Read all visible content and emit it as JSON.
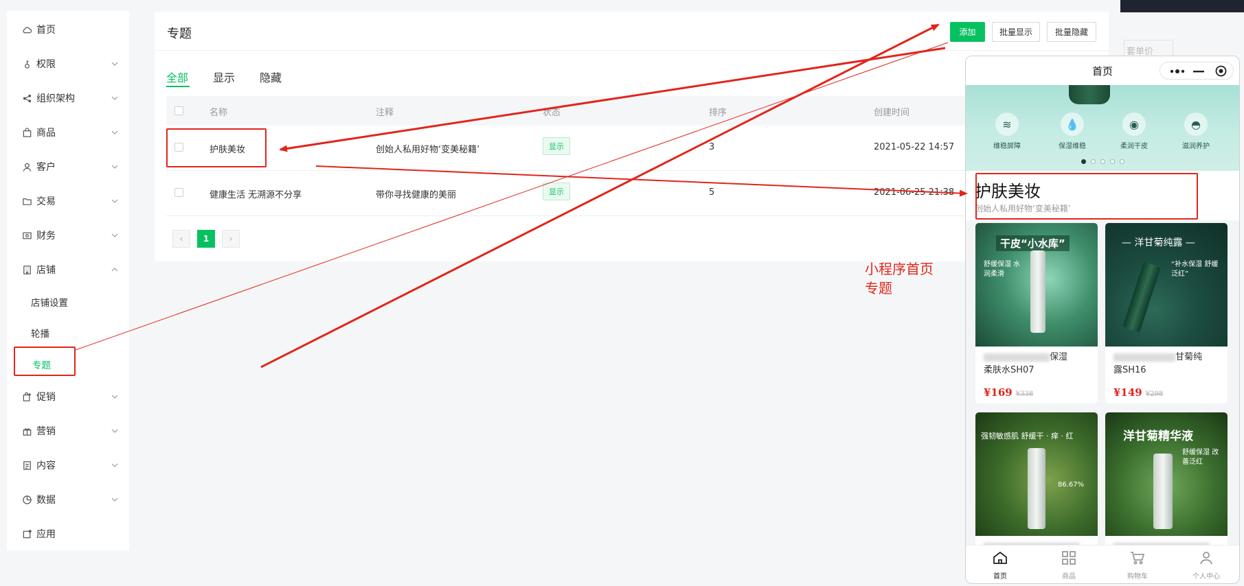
{
  "sidebar": {
    "items": [
      {
        "label": "首页",
        "icon": "cloud-icon"
      },
      {
        "label": "权限",
        "icon": "key-icon"
      },
      {
        "label": "组织架构",
        "icon": "share-icon"
      },
      {
        "label": "商品",
        "icon": "bag-icon"
      },
      {
        "label": "客户",
        "icon": "user-icon"
      },
      {
        "label": "交易",
        "icon": "folder-icon"
      },
      {
        "label": "财务",
        "icon": "wallet-icon"
      },
      {
        "label": "店铺",
        "icon": "store-icon"
      }
    ],
    "store_sub": [
      "店铺设置",
      "轮播",
      "专题"
    ],
    "items_after": [
      {
        "label": "促销",
        "icon": "promo-icon"
      },
      {
        "label": "营销",
        "icon": "gift-icon"
      },
      {
        "label": "内容",
        "icon": "document-icon"
      },
      {
        "label": "数据",
        "icon": "pie-chart-icon"
      },
      {
        "label": "应用",
        "icon": "app-icon"
      }
    ]
  },
  "panel": {
    "title": "专题",
    "buttons": {
      "add": "添加",
      "batch_show": "批量显示",
      "batch_hide": "批量隐藏"
    },
    "tabs": [
      "全部",
      "显示",
      "隐藏"
    ],
    "columns": [
      "名称",
      "注释",
      "状态",
      "排序",
      "创建时间"
    ],
    "rows": [
      {
        "name": "护肤美妆",
        "note": "创始人私用好物‘变美秘籍’",
        "status": "显示",
        "sort": "3",
        "created": "2021-05-22 14:57"
      },
      {
        "name": "健康生活 无溯源不分享",
        "note": "带你寻找健康的美丽",
        "status": "显示",
        "sort": "5",
        "created": "2021-06-25 21:38"
      }
    ],
    "pager": {
      "prev": "‹",
      "current": "1",
      "next": "›"
    }
  },
  "background": {
    "ghost_label": "套单价"
  },
  "annotation": {
    "line1": "小程序首页",
    "line2": "专题"
  },
  "phone": {
    "title": "首页",
    "features": [
      "维稳屏障",
      "保湿维稳",
      "柔润干皮",
      "滋润养护"
    ],
    "topic": {
      "title": "护肤美妆",
      "subtitle": "创始人私用好物‘变美秘籍’"
    },
    "products": [
      {
        "img_text": "干皮“小水库”",
        "img_sub": "舒缓保湿 水润柔滑",
        "name_tail": "保湿",
        "name_line2": "柔肤水SH07",
        "price": "¥169",
        "old_price": "¥338"
      },
      {
        "img_text": "— 洋甘菊纯露 —",
        "img_sub": "“补水保湿 舒缓泛红”",
        "name_tail": "甘菊纯",
        "name_line2": "露SH16",
        "price": "¥149",
        "old_price": "¥298"
      },
      {
        "img_text": "强韧敏感肌 舒缓干 · 痒 · 红",
        "img_sub": "86.67%"
      },
      {
        "img_text": "洋甘菊精华液",
        "img_sub": "舒缓保湿 改善泛红"
      }
    ],
    "tabbar": [
      "首页",
      "商品",
      "购物车",
      "个人中心"
    ]
  },
  "colors": {
    "accent": "#07c160",
    "annotation": "#e1251b",
    "price": "#e1251b"
  }
}
